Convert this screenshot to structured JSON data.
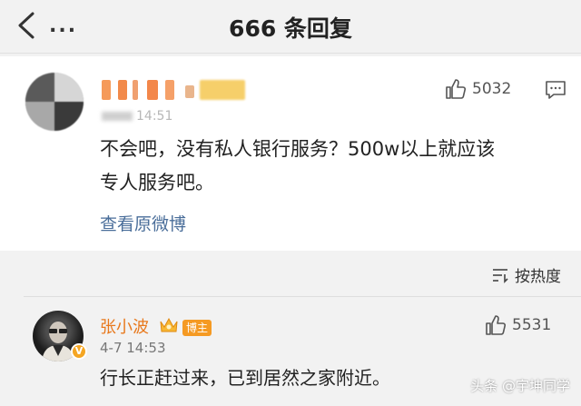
{
  "header": {
    "back_icon": "chevron-left-icon",
    "more_label": "...",
    "title": "666 条回复"
  },
  "original_comment": {
    "username": "",
    "date": "14:51",
    "like_count": "5032",
    "like_icon": "thumbs-up-icon",
    "comment_icon": "comment-icon",
    "text_line1": "不会吧，没有私人银行服务？500w以上就应该",
    "text_line2": "专人服务吧。",
    "view_original_label": "查看原微博"
  },
  "sort": {
    "label": "按热度",
    "icon": "sort-icon"
  },
  "reply": {
    "username": "张小波",
    "author_tag": "博主",
    "verify_badge": "V",
    "time": "4-7 14:53",
    "like_count": "5531",
    "text": "行长正赶过来，已到居然之家附近。"
  },
  "watermark": "头条 @宇坤同学",
  "colors": {
    "link_blue": "#4a6e9a",
    "username_orange": "#e8791d",
    "tag_orange": "#f59a23",
    "background": "#f2f2f2",
    "card": "#ffffff"
  }
}
